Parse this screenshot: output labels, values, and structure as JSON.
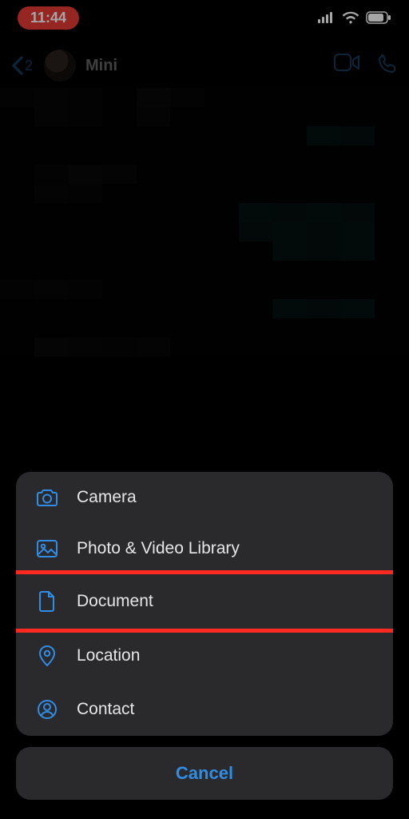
{
  "status": {
    "time": "11:44"
  },
  "header": {
    "back_count": "2",
    "contact_name": "Mini"
  },
  "sheet": {
    "items": [
      {
        "icon": "camera-icon",
        "label": "Camera"
      },
      {
        "icon": "photo-library-icon",
        "label": "Photo & Video Library"
      },
      {
        "icon": "document-icon",
        "label": "Document",
        "highlight": true
      },
      {
        "icon": "location-icon",
        "label": "Location"
      },
      {
        "icon": "contact-icon",
        "label": "Contact"
      }
    ],
    "cancel_label": "Cancel"
  }
}
